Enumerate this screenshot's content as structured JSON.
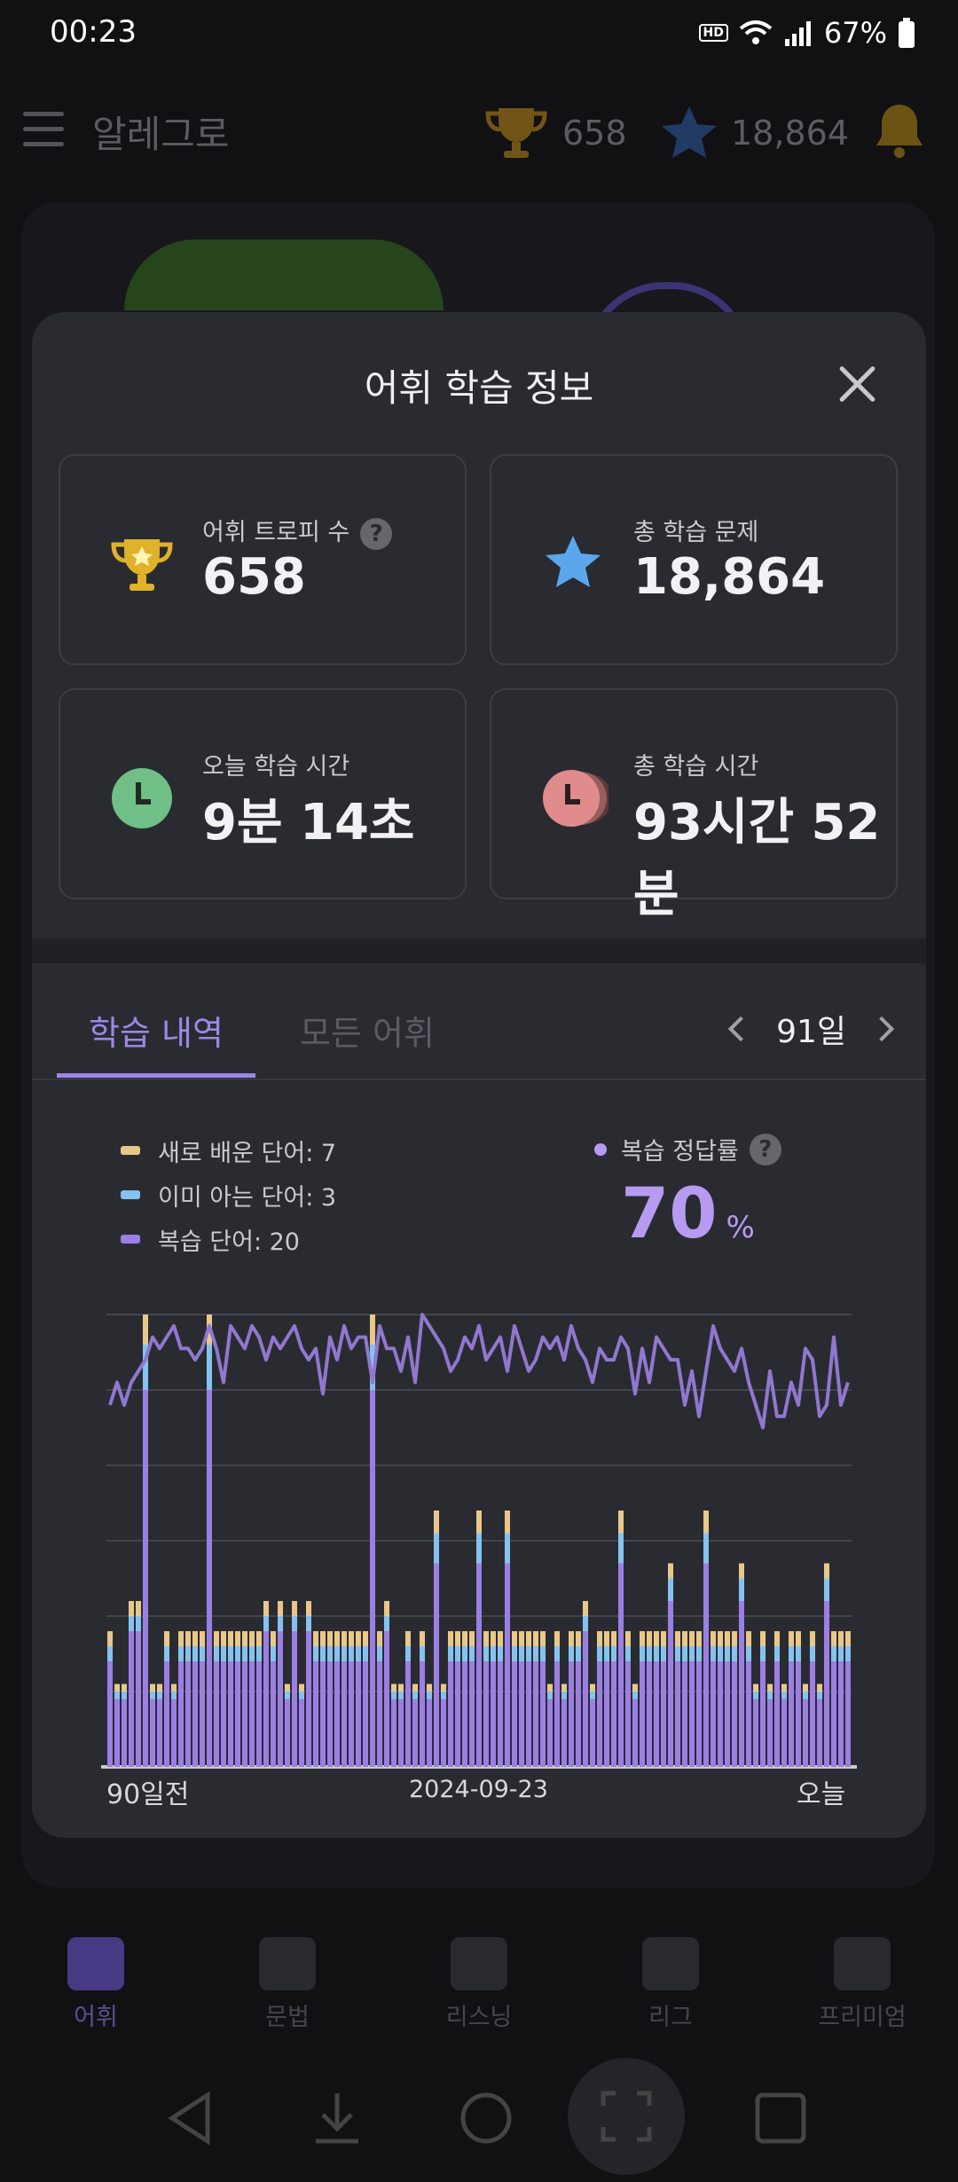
{
  "status_bar": {
    "time": "00:23",
    "hd_label": "HD",
    "battery": "67%"
  },
  "app_bar": {
    "title": "알레그로",
    "trophies": "658",
    "stars": "18,864"
  },
  "sheet": {
    "title": "어휘 학습 정보",
    "cards": [
      {
        "label": "어휘 트로피 수",
        "value": "658",
        "icon": "trophy-icon"
      },
      {
        "label": "총 학습 문제",
        "value": "18,864",
        "icon": "star-icon"
      },
      {
        "label": "오늘 학습 시간",
        "value": "9분 14초",
        "icon": "clock-icon"
      },
      {
        "label": "총 학습 시간",
        "value": "93시간 52분",
        "icon": "stacked-clock-icon"
      }
    ],
    "help_mark": "?"
  },
  "tabs": {
    "history": "학습 내역",
    "all_words": "모든 어휘",
    "period": "91일"
  },
  "legend": {
    "new_words": "새로 배운 단어: 7",
    "known_words": "이미 아는 단어: 3",
    "review_words": "복습 단어: 20"
  },
  "accuracy": {
    "label": "복습 정답률",
    "value": "70",
    "unit": "%"
  },
  "colors": {
    "new": "#e8c88a",
    "known": "#86c2f0",
    "review": "#9b7fe3",
    "line": "#9077cf",
    "accent": "#9d87e6"
  },
  "chart_data": {
    "type": "bar",
    "stacked": true,
    "x_start_label": "90일전",
    "x_mid_label": "2024-09-23",
    "x_end_label": "오늘",
    "grid": true,
    "series": [
      {
        "name": "복습 단어",
        "values": [
          14,
          9,
          9,
          18,
          18,
          50,
          9,
          9,
          14,
          9,
          14,
          14,
          14,
          14,
          50,
          14,
          14,
          14,
          14,
          14,
          14,
          14,
          18,
          14,
          18,
          9,
          18,
          9,
          18,
          14,
          14,
          14,
          14,
          14,
          14,
          14,
          14,
          50,
          14,
          18,
          9,
          9,
          14,
          9,
          14,
          9,
          27,
          9,
          14,
          14,
          14,
          14,
          27,
          14,
          14,
          14,
          27,
          14,
          14,
          14,
          14,
          14,
          9,
          14,
          9,
          14,
          14,
          18,
          9,
          14,
          14,
          14,
          27,
          14,
          9,
          14,
          14,
          14,
          14,
          22,
          14,
          14,
          14,
          14,
          27,
          14,
          14,
          14,
          14,
          22,
          14,
          9,
          14,
          9,
          14,
          9,
          14,
          14,
          9,
          14,
          9,
          22,
          14,
          14,
          14
        ]
      },
      {
        "name": "이미 아는 단어",
        "values": [
          2,
          1,
          1,
          2,
          2,
          6,
          1,
          1,
          2,
          1,
          2,
          2,
          2,
          2,
          6,
          2,
          2,
          2,
          2,
          2,
          2,
          2,
          2,
          2,
          2,
          1,
          2,
          1,
          2,
          2,
          2,
          2,
          2,
          2,
          2,
          2,
          2,
          6,
          2,
          2,
          1,
          1,
          2,
          1,
          2,
          1,
          4,
          1,
          2,
          2,
          2,
          2,
          4,
          2,
          2,
          2,
          4,
          2,
          2,
          2,
          2,
          2,
          1,
          2,
          1,
          2,
          2,
          2,
          1,
          2,
          2,
          2,
          4,
          2,
          1,
          2,
          2,
          2,
          2,
          3,
          2,
          2,
          2,
          2,
          4,
          2,
          2,
          2,
          2,
          3,
          2,
          1,
          2,
          1,
          2,
          1,
          2,
          2,
          1,
          2,
          1,
          3,
          2,
          2,
          2
        ]
      },
      {
        "name": "새로 배운 단어",
        "values": [
          2,
          1,
          1,
          2,
          2,
          4,
          1,
          1,
          2,
          1,
          2,
          2,
          2,
          2,
          4,
          2,
          2,
          2,
          2,
          2,
          2,
          2,
          2,
          2,
          2,
          1,
          2,
          1,
          2,
          2,
          2,
          2,
          2,
          2,
          2,
          2,
          2,
          4,
          2,
          2,
          1,
          1,
          2,
          1,
          2,
          1,
          3,
          1,
          2,
          2,
          2,
          2,
          3,
          2,
          2,
          2,
          3,
          2,
          2,
          2,
          2,
          2,
          1,
          2,
          1,
          2,
          2,
          2,
          1,
          2,
          2,
          2,
          3,
          2,
          1,
          2,
          2,
          2,
          2,
          2,
          2,
          2,
          2,
          2,
          3,
          2,
          2,
          2,
          2,
          2,
          2,
          1,
          2,
          1,
          2,
          1,
          2,
          2,
          1,
          2,
          1,
          2,
          2,
          2,
          2
        ]
      },
      {
        "name": "복습 정답률",
        "type": "line",
        "values": [
          60,
          70,
          60,
          70,
          75,
          80,
          90,
          85,
          90,
          95,
          85,
          85,
          80,
          85,
          95,
          85,
          70,
          95,
          90,
          85,
          95,
          90,
          80,
          90,
          85,
          90,
          95,
          85,
          80,
          85,
          65,
          90,
          80,
          95,
          85,
          90,
          90,
          70,
          95,
          85,
          85,
          75,
          90,
          70,
          100,
          95,
          90,
          85,
          75,
          80,
          90,
          85,
          95,
          80,
          85,
          90,
          75,
          95,
          85,
          75,
          80,
          90,
          85,
          90,
          80,
          95,
          85,
          80,
          70,
          85,
          80,
          80,
          90,
          85,
          65,
          85,
          70,
          90,
          85,
          80,
          80,
          60,
          75,
          55,
          75,
          95,
          85,
          80,
          75,
          85,
          70,
          60,
          50,
          75,
          55,
          55,
          70,
          60,
          85,
          80,
          55,
          60,
          90,
          60,
          70
        ]
      }
    ]
  },
  "bottom_nav": [
    "어휘",
    "문법",
    "리스닝",
    "리그",
    "프리미엄"
  ]
}
